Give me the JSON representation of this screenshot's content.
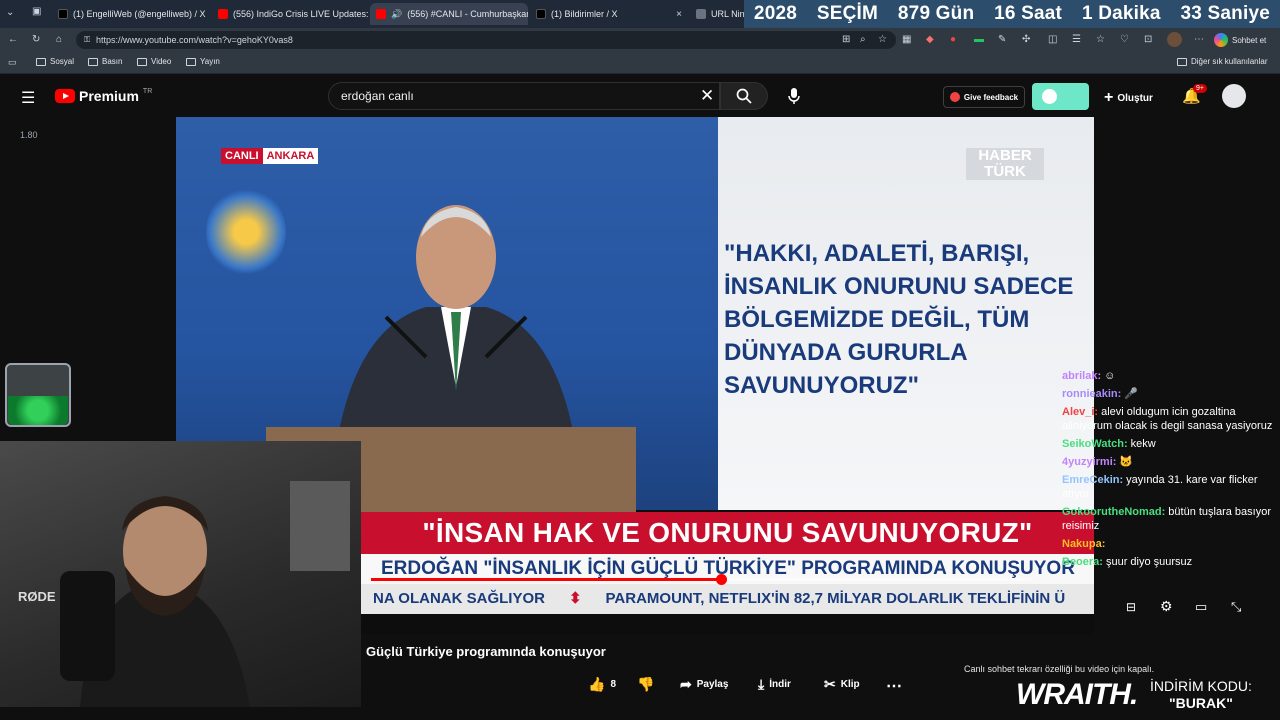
{
  "tabs": [
    {
      "label": "(1) EngelliWeb (@engelliweb) / X",
      "fav": "x-logo",
      "color": "#000000"
    },
    {
      "label": "(556) IndiGo Crisis LIVE Updates: C",
      "fav": "youtube-logo",
      "color": "#ff0000"
    },
    {
      "label": "(556) #CANLI - Cumhurbaşkan",
      "fav": "youtube-logo",
      "color": "#ff0000",
      "active": true
    },
    {
      "label": "(1) Bildirimler / X",
      "fav": "x-logo",
      "color": "#000000"
    },
    {
      "label": "URL Ninj",
      "fav": "globe-icon",
      "color": "#6b7280"
    }
  ],
  "banner": {
    "year": "2028",
    "seçim": "SEÇİM",
    "days": "879 Gün",
    "hours": "16 Saat",
    "minutes": "1 Dakika",
    "seconds": "33 Saniye"
  },
  "address": {
    "url": "https://www.youtube.com/watch?v=gehoKY0vas8",
    "profile_label": "Sohbet et"
  },
  "bookmarks": [
    "Sosyal",
    "Basın",
    "Video",
    "Yayın"
  ],
  "bookmarks_right": "Diğer sık kullanılanlar",
  "youtube": {
    "brand": "Premium",
    "region": "TR",
    "search_value": "erdoğan canlı",
    "feedback": "Give feedback",
    "create": "Oluştur",
    "notifications": "9+"
  },
  "video": {
    "live_tag": "CANLI",
    "location": "ANKARA",
    "channel": "HABER TÜRK",
    "quote": "\"HAKKI, ADALETİ, BARIŞI, İNSANLIK ONURUNU SADECE BÖLGEMİZDE DEĞİL, TÜM DÜNYADA GURURLA SAVUNUYORUZ\"",
    "headline": "\"İNSAN HAK VE ONURUNU SAVUNUYORUZ\"",
    "subheadline": "ERDOĞAN \"İNSANLIK İÇİN GÜÇLÜ TÜRKİYE\" PROGRAMINDA KONUŞUYOR",
    "ticker": [
      "NA OLANAK SAĞLIYOR",
      "PARAMOUNT, NETFLIX'İN 82,7 MİLYAR DOLARLIK TEKLİFİNİN Ü"
    ],
    "progress": 0.53,
    "speed": "1.80"
  },
  "chat": [
    {
      "name": "abrilak:",
      "color": "#c084fc",
      "text": "☺"
    },
    {
      "name": "ronnieakin:",
      "color": "#a78bfa",
      "text": "🎤"
    },
    {
      "name": "Alev_i:",
      "color": "#ef4444",
      "text": "alevi oldugum icin gozaltina aliniyorum olacak is degil sanasa yasiyoruz"
    },
    {
      "name": "SeikoWatch:",
      "color": "#4ade80",
      "text": "kekw"
    },
    {
      "name": "4yuzyirmi:",
      "color": "#c084fc",
      "text": "🐱"
    },
    {
      "name": "EmreCekin:",
      "color": "#93c5fd",
      "text": "yayında 31. kare var flicker atıyor"
    },
    {
      "name": "GokooruthеNomad:",
      "color": "#4ade80",
      "text": "bütün tuşlara basıyor reisimiz"
    },
    {
      "name": "Nakupa:",
      "color": "#fbbf24",
      "text": ""
    },
    {
      "name": "Beoera:",
      "color": "#4ade80",
      "text": "şuur diyo şuursuz"
    }
  ],
  "below": {
    "title": "Güçlü Türkiye programında konuşuyor",
    "likes": "8",
    "share": "Paylaş",
    "download": "İndir",
    "clip": "Klip",
    "chat_off": "Canlı sohbet tekrarı özelliği bu video için kapalı."
  },
  "promo": {
    "brand": "WRAITH.",
    "line1": "İNDİRİM KODU:",
    "line2": "\"BURAK\""
  }
}
